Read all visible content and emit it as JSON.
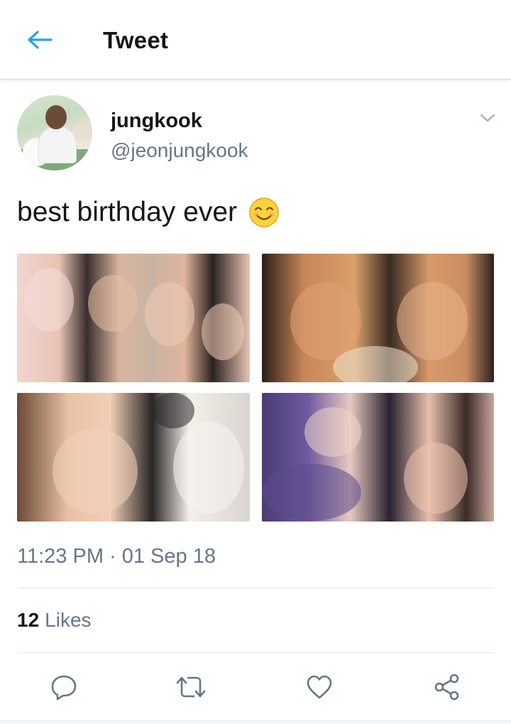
{
  "header": {
    "title": "Tweet",
    "back_icon": "arrow-left-icon",
    "accent_color": "#1da1f2"
  },
  "author": {
    "display_name": "jungkook",
    "handle": "@jeonjungkook",
    "menu_icon": "chevron-down-icon"
  },
  "tweet": {
    "text": "best birthday ever",
    "emoji_icon": "smiling-face-emoji-icon",
    "photos": [
      {
        "label": "photo-1"
      },
      {
        "label": "photo-2"
      },
      {
        "label": "photo-3"
      },
      {
        "label": "photo-4"
      }
    ],
    "timestamp": "11:23 PM · 01 Sep 18"
  },
  "stats": {
    "likes_count": "12",
    "likes_label": "Likes"
  },
  "actions": [
    {
      "name": "reply-button",
      "icon": "reply-icon"
    },
    {
      "name": "retweet-button",
      "icon": "retweet-icon"
    },
    {
      "name": "like-button",
      "icon": "heart-icon"
    },
    {
      "name": "share-button",
      "icon": "share-icon"
    }
  ],
  "colors": {
    "text_primary": "#14171a",
    "text_secondary": "#657786",
    "divider": "#e1e8ed",
    "icon_gray": "#657786"
  }
}
